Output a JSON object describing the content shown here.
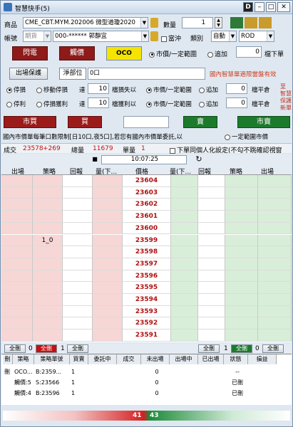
{
  "title": "智慧快手(5)",
  "header": {
    "product_label": "商品",
    "product_value": "CME_CBT.MYM.202006 微型道瓊2020",
    "qty_label": "數量",
    "qty_value": "1",
    "account_label": "帳號",
    "account_type": "期貨",
    "account_value": "000-****** 郭靜宜",
    "day_trade_label": "當沖",
    "category_label": "類別",
    "category_value": "自動",
    "rod_value": "ROD"
  },
  "buttons": {
    "flash": "閃電",
    "touch": "觸價",
    "oco": "OCO",
    "exit_protect": "出場保護",
    "net_position_label": "淨部位",
    "net_position_value": "0口"
  },
  "radio_market": "市價/一定範圍",
  "radio_chase": "追加",
  "ticks_value": "0",
  "ticks_label": "檔下單",
  "notice": "國內智慧單適限當盤有效",
  "stop_rows": [
    {
      "r1": "停損",
      "r2": "移動停損",
      "label1": "達",
      "v1": "10",
      "label2": "檔損失以",
      "rm": "市價/一定範圍",
      "ra": "追加",
      "v3": "0",
      "label3": "檔平倉"
    },
    {
      "r1": "停利",
      "r2": "停損獲利",
      "label1": "達",
      "v1": "10",
      "label2": "檔獲利以",
      "rm": "市價/一定範圍",
      "ra": "追加",
      "v3": "0",
      "label3": "檔平倉"
    }
  ],
  "side_text": [
    "至",
    "智慧",
    "保護",
    "新單"
  ],
  "trade": {
    "market_buy": "市買",
    "buy": "買",
    "sell": "賣",
    "market_sell": "市賣"
  },
  "warning": "國內市價單每筆口數限制[日10口,夜5口],若您有國內市價單委託,以",
  "warning_radio": "一定範圍市價",
  "stats": {
    "deal_label": "成交",
    "deal_price": "23578",
    "deal_change": "+269",
    "volume_label": "總量",
    "volume_value": "11679",
    "single_label": "單量",
    "single_value": "1",
    "checkbox_label": "下單同個人化設定(不勾不跳確認視窗"
  },
  "clock": "10:07:25",
  "ladder": {
    "headers": [
      "出場",
      "策略",
      "回報",
      "量(下...",
      "價格",
      "量(下...",
      "回報",
      "策略",
      "出場"
    ],
    "prices": [
      "23604",
      "23603",
      "23602",
      "23601",
      "23600",
      "23599",
      "23598",
      "23597",
      "23596",
      "23595",
      "23594",
      "23593",
      "23592",
      "23591"
    ],
    "strategy_marker": "1_0"
  },
  "bulk": {
    "all_cancel": "全刪",
    "count_left": "0",
    "all_cancel_red": "全刪",
    "count_mid": "1",
    "all_cancel2": "全刪",
    "count_right": "1",
    "all_cancel3": "全刪",
    "count_r2": "0"
  },
  "orders": {
    "headers": [
      "刪",
      "策略",
      "策略單號",
      "買賣",
      "委託中",
      "成交",
      "未出場",
      "出場中",
      "已出場",
      "狀態",
      "損益"
    ],
    "rows": [
      [
        "刪",
        "OCO...",
        "B:2359...",
        "1",
        "",
        "",
        "0",
        "",
        "",
        "--",
        ""
      ],
      [
        "",
        "觸價:5",
        "S:23566",
        "1",
        "",
        "",
        "0",
        "",
        "",
        "已刪",
        ""
      ],
      [
        "",
        "觸價:4",
        "B:23596",
        "1",
        "",
        "",
        "0",
        "",
        "",
        "已刪",
        ""
      ]
    ]
  },
  "imbalance": {
    "left": "41",
    "right": "43"
  }
}
